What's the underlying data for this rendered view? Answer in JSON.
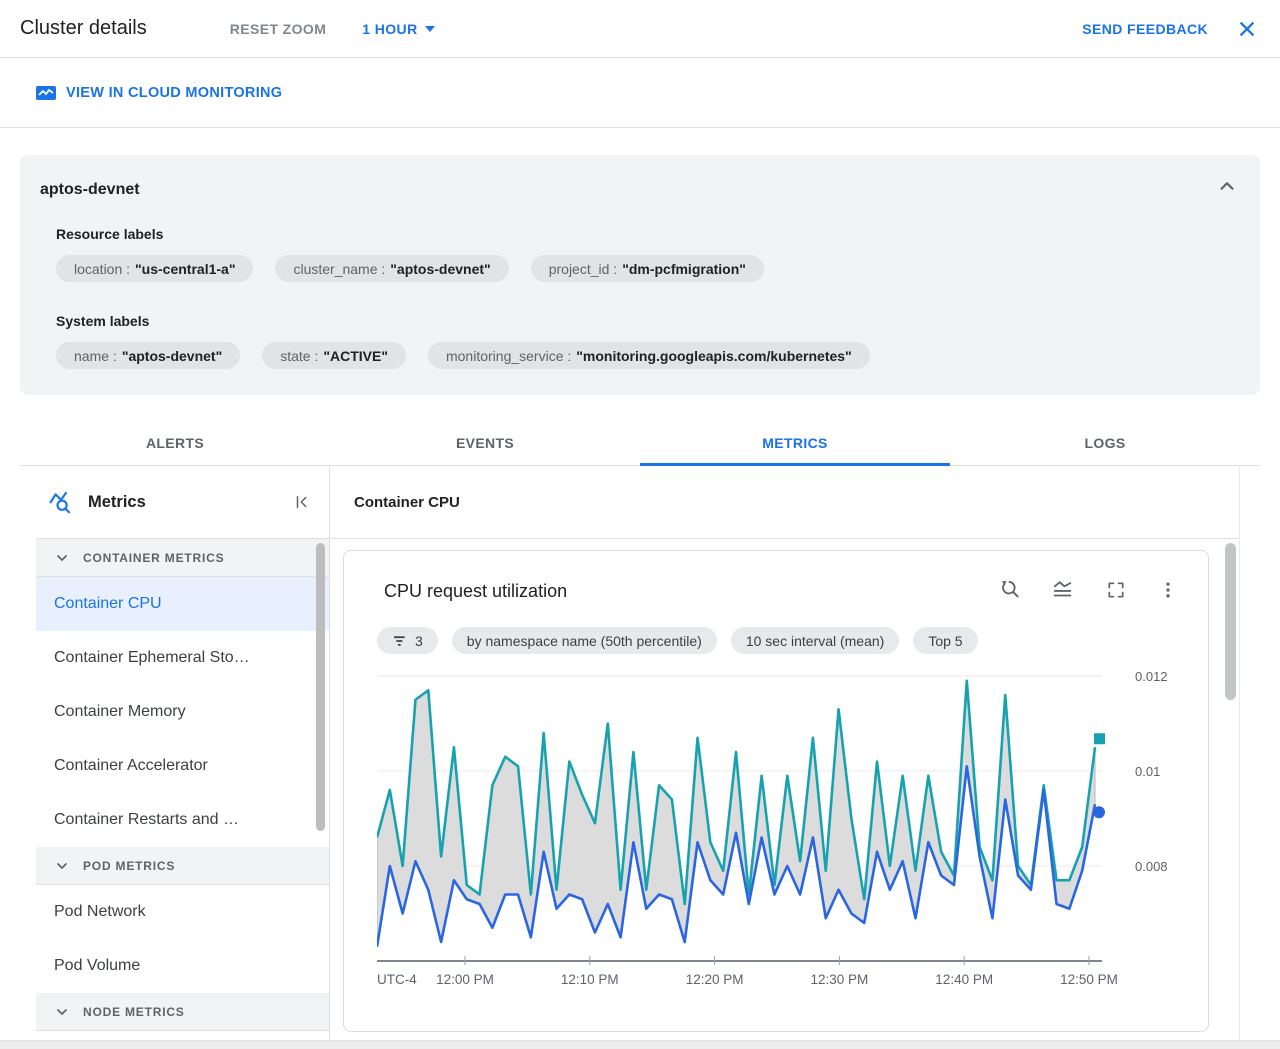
{
  "header": {
    "title": "Cluster details",
    "reset_zoom": "RESET ZOOM",
    "time_range": "1 HOUR",
    "send_feedback": "SEND FEEDBACK"
  },
  "toolbar": {
    "view_in_monitoring": "VIEW IN CLOUD MONITORING"
  },
  "cluster_card": {
    "name": "aptos-devnet",
    "resource_labels_title": "Resource labels",
    "resource_labels": [
      {
        "key": "location :",
        "value": "\"us-central1-a\""
      },
      {
        "key": "cluster_name :",
        "value": "\"aptos-devnet\""
      },
      {
        "key": "project_id :",
        "value": "\"dm-pcfmigration\""
      }
    ],
    "system_labels_title": "System labels",
    "system_labels": [
      {
        "key": "name :",
        "value": "\"aptos-devnet\""
      },
      {
        "key": "state :",
        "value": "\"ACTIVE\""
      },
      {
        "key": "monitoring_service :",
        "value": "\"monitoring.googleapis.com/kubernetes\""
      }
    ]
  },
  "tabs": [
    {
      "label": "ALERTS"
    },
    {
      "label": "EVENTS"
    },
    {
      "label": "METRICS"
    },
    {
      "label": "LOGS"
    }
  ],
  "sidebar": {
    "title": "Metrics",
    "groups": [
      {
        "header": "CONTAINER METRICS",
        "items": [
          {
            "label": "Container CPU"
          },
          {
            "label": "Container Ephemeral Sto…"
          },
          {
            "label": "Container Memory"
          },
          {
            "label": "Container Accelerator"
          },
          {
            "label": "Container Restarts and …"
          }
        ]
      },
      {
        "header": "POD METRICS",
        "items": [
          {
            "label": "Pod Network"
          },
          {
            "label": "Pod Volume"
          }
        ]
      },
      {
        "header": "NODE METRICS",
        "items": []
      }
    ]
  },
  "panel": {
    "title": "Container CPU"
  },
  "chart_card": {
    "title": "CPU request utilization",
    "filter_count": "3",
    "chips": [
      {
        "label": "by namespace name (50th percentile)"
      },
      {
        "label": "10 sec interval (mean)"
      },
      {
        "label": "Top 5"
      }
    ]
  },
  "chart_data": {
    "type": "line",
    "title": "CPU request utilization",
    "x_axis_prefix": "UTC-4",
    "x_tick_labels": [
      "12:00 PM",
      "12:10 PM",
      "12:20 PM",
      "12:30 PM",
      "12:40 PM",
      "12:50 PM"
    ],
    "y_ticks": [
      0.012,
      0.01,
      0.008
    ],
    "y_axis_value": 0.006,
    "ylim": [
      0.006,
      0.0123
    ],
    "grid": true,
    "legend": "none",
    "band_fill_between_series": true,
    "band_color": "#dcdcdc",
    "series": [
      {
        "name": "series-upper",
        "color": "#17a2b0",
        "marker": "square",
        "values": [
          0.0086,
          0.0096,
          0.008,
          0.0115,
          0.0117,
          0.0082,
          0.0105,
          0.0076,
          0.0074,
          0.0097,
          0.0103,
          0.0101,
          0.0074,
          0.0108,
          0.0075,
          0.0102,
          0.0095,
          0.0089,
          0.011,
          0.0075,
          0.0104,
          0.0075,
          0.0097,
          0.0094,
          0.0072,
          0.0107,
          0.0085,
          0.0079,
          0.0104,
          0.0074,
          0.0099,
          0.0076,
          0.0099,
          0.0081,
          0.0107,
          0.0079,
          0.0113,
          0.009,
          0.0073,
          0.0102,
          0.008,
          0.0099,
          0.0079,
          0.0099,
          0.0083,
          0.0078,
          0.0119,
          0.0084,
          0.0077,
          0.0116,
          0.008,
          0.0076,
          0.0097,
          0.0077,
          0.0077,
          0.0084,
          0.0105
        ]
      },
      {
        "name": "series-lower",
        "color": "#2a66e0",
        "marker": "circle",
        "values": [
          0.0063,
          0.008,
          0.007,
          0.0081,
          0.0075,
          0.0064,
          0.0077,
          0.0073,
          0.0072,
          0.0067,
          0.0074,
          0.0074,
          0.0065,
          0.0083,
          0.0071,
          0.0074,
          0.0073,
          0.0066,
          0.0072,
          0.0065,
          0.0085,
          0.0071,
          0.0074,
          0.0073,
          0.0064,
          0.0085,
          0.0077,
          0.0074,
          0.0087,
          0.0072,
          0.0086,
          0.0074,
          0.008,
          0.0074,
          0.0086,
          0.0069,
          0.0075,
          0.007,
          0.0068,
          0.0083,
          0.0075,
          0.0081,
          0.0069,
          0.0085,
          0.0078,
          0.0076,
          0.0101,
          0.0082,
          0.0069,
          0.0094,
          0.0078,
          0.0075,
          0.0096,
          0.0072,
          0.0071,
          0.0079,
          0.0093
        ]
      }
    ]
  },
  "colors": {
    "accent": "#1a73e8",
    "teal": "#17a2b0",
    "blue": "#2a66e0",
    "band": "#dcdcdc",
    "grid": "#e8eaed",
    "axis": "#80868b"
  }
}
